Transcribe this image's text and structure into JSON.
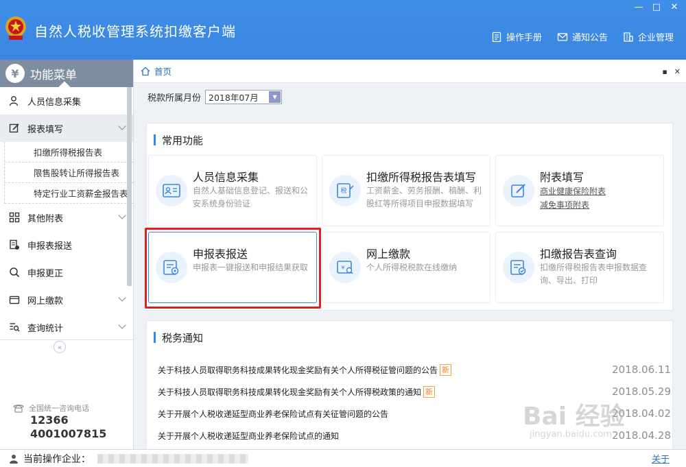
{
  "window": {
    "title": "自然人税收管理系统扣缴客户端",
    "controls": [
      "—",
      "□",
      "✕"
    ]
  },
  "top_links": [
    {
      "label": "操作手册",
      "icon": "manual-icon"
    },
    {
      "label": "通知公告",
      "icon": "mail-icon"
    },
    {
      "label": "企业管理",
      "icon": "building-icon"
    }
  ],
  "sidebar": {
    "header": "功能菜单",
    "coin_glyph": "¥",
    "items": [
      {
        "label": "人员信息采集",
        "icon": "person-icon"
      },
      {
        "label": "报表填写",
        "icon": "edit-icon",
        "active": true
      },
      {
        "label": "其他附表",
        "icon": "grid-icon"
      },
      {
        "label": "申报表报送",
        "icon": "send-report-icon"
      },
      {
        "label": "申报更正",
        "icon": "search-icon"
      },
      {
        "label": "网上缴款",
        "icon": "wallet-icon"
      },
      {
        "label": "查询统计",
        "icon": "query-icon"
      }
    ],
    "subitems": [
      "扣缴所得税报告表",
      "限售股转让所得报告表",
      "特定行业工资薪金报告表"
    ],
    "collapse_glyph": "«",
    "hotline_label": "全国统一咨询电话",
    "hotline_numbers": [
      "12366",
      "4001007815"
    ]
  },
  "main": {
    "breadcrumb": "首页",
    "month_label": "税款所属月份",
    "month_value": "2018年07月",
    "common_title": "常用功能",
    "cards": [
      {
        "title": "人员信息采集",
        "desc": "自然人基础信息登记、报送和公安系统身份验证",
        "icon": "id-card-icon"
      },
      {
        "title": "扣缴所得税报告表填写",
        "desc": "工资薪金、劳务报酬、稿酬、利股红等所得项目申报数据填写",
        "icon": "tax-form-icon"
      },
      {
        "title": "附表填写",
        "links": [
          "商业健康保险附表",
          "减免事项附表"
        ],
        "icon": "pencil-icon"
      },
      {
        "title": "申报表报送",
        "desc": "申报表一键报送和申报结果获取",
        "icon": "submit-form-icon"
      },
      {
        "title": "网上缴款",
        "desc": "个人所得税税款在线缴纳",
        "icon": "online-pay-icon"
      },
      {
        "title": "扣缴报告表查询",
        "desc": "扣缴所得税报告表申报数据查询、导出、打印",
        "icon": "report-query-icon"
      }
    ],
    "notice_title": "税务通知",
    "notices": [
      {
        "text": "关于科技人员取得职务科技成果转化现金奖励有关个人所得税征管问题的公告",
        "badge": "新",
        "date": "2018.06.11"
      },
      {
        "text": "关于科技人员取得职务科技成果转化现金奖励有关个人所得税政策的通知",
        "badge": "新",
        "date": "2018.05.29"
      },
      {
        "text": "关于开展个人税收递延型商业养老保险试点有关征管问题的公告",
        "badge": "",
        "date": "2018.04.02"
      },
      {
        "text": "关于开展个人税收递延型商业养老保险试点的通知",
        "badge": "",
        "date": "2018.04.28"
      }
    ]
  },
  "statusbar": {
    "label": "当前操作企业：",
    "about": "关于"
  },
  "watermark": {
    "main": "Bai 经验",
    "sub": "jingyan.baidu.com"
  }
}
